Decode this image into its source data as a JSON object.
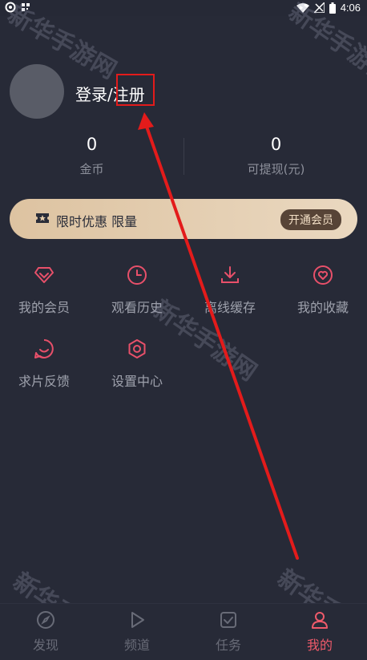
{
  "status_bar": {
    "time": "4:06"
  },
  "profile": {
    "login_label": "登录/注册"
  },
  "stats": [
    {
      "value": "0",
      "label": "金币"
    },
    {
      "value": "0",
      "label": "可提现(元)"
    }
  ],
  "vip_banner": {
    "text": "限时优惠 限量",
    "button": "开通会员"
  },
  "menu": [
    {
      "label": "我的会员",
      "icon": "diamond-icon"
    },
    {
      "label": "观看历史",
      "icon": "clock-icon"
    },
    {
      "label": "离线缓存",
      "icon": "download-icon"
    },
    {
      "label": "我的收藏",
      "icon": "heart-icon"
    },
    {
      "label": "求片反馈",
      "icon": "feedback-icon"
    },
    {
      "label": "设置中心",
      "icon": "settings-icon"
    }
  ],
  "tabs": [
    {
      "label": "发现",
      "icon": "compass-icon",
      "active": false
    },
    {
      "label": "频道",
      "icon": "play-icon",
      "active": false
    },
    {
      "label": "任务",
      "icon": "task-icon",
      "active": false
    },
    {
      "label": "我的",
      "icon": "user-icon",
      "active": true
    }
  ],
  "watermark": "新华手游网",
  "colors": {
    "accent": "#ee5a6a",
    "icon": "#e8506a",
    "background": "#272a37",
    "annotation": "#e31b1b"
  }
}
